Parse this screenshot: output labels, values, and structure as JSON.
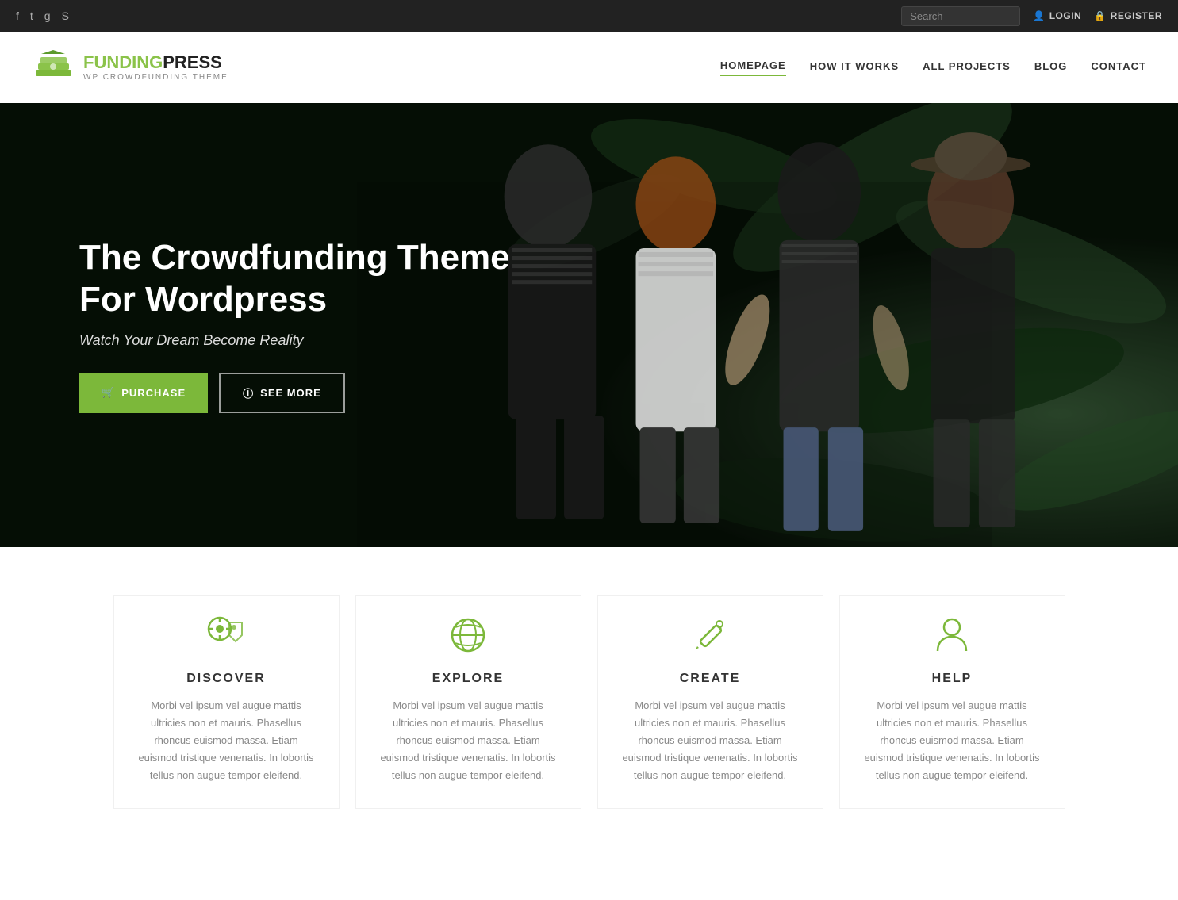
{
  "topbar": {
    "social": [
      "f",
      "t",
      "g+",
      "s"
    ],
    "social_names": [
      "facebook-icon",
      "twitter-icon",
      "googleplus-icon",
      "skype-icon"
    ],
    "search_placeholder": "Search",
    "login_label": "LOGIN",
    "register_label": "REGISTER"
  },
  "header": {
    "logo_funding": "FUNDING",
    "logo_press": "PRESS",
    "logo_sub": "WP CROWDFUNDING THEME",
    "nav": [
      {
        "label": "HOMEPAGE",
        "active": true
      },
      {
        "label": "HOW IT WORKS",
        "active": false
      },
      {
        "label": "ALL PROJECTS",
        "active": false
      },
      {
        "label": "BLOG",
        "active": false
      },
      {
        "label": "CONTACT",
        "active": false
      }
    ]
  },
  "hero": {
    "title": "The Crowdfunding Theme For Wordpress",
    "subtitle": "Watch Your Dream Become Reality",
    "purchase_label": "PURCHASE",
    "seemore_label": "SEE MORE"
  },
  "features": [
    {
      "id": "discover",
      "title": "DISCOVER",
      "icon": "tag-icon",
      "text": "Morbi vel ipsum vel augue mattis ultricies non et mauris. Phasellus rhoncus euismod massa. Etiam euismod tristique venenatis. In lobortis tellus non augue tempor eleifend."
    },
    {
      "id": "explore",
      "title": "EXPLORE",
      "icon": "globe-icon",
      "text": "Morbi vel ipsum vel augue mattis ultricies non et mauris. Phasellus rhoncus euismod massa. Etiam euismod tristique venenatis. In lobortis tellus non augue tempor eleifend."
    },
    {
      "id": "create",
      "title": "CREATE",
      "icon": "pencil-icon",
      "text": "Morbi vel ipsum vel augue mattis ultricies non et mauris. Phasellus rhoncus euismod massa. Etiam euismod tristique venenatis. In lobortis tellus non augue tempor eleifend."
    },
    {
      "id": "help",
      "title": "HELP",
      "icon": "person-icon",
      "text": "Morbi vel ipsum vel augue mattis ultricies non et mauris. Phasellus rhoncus euismod massa. Etiam euismod tristique venenatis. In lobortis tellus non augue tempor eleifend."
    }
  ],
  "colors": {
    "accent": "#7cb83a",
    "dark": "#222222",
    "text": "#888888"
  }
}
